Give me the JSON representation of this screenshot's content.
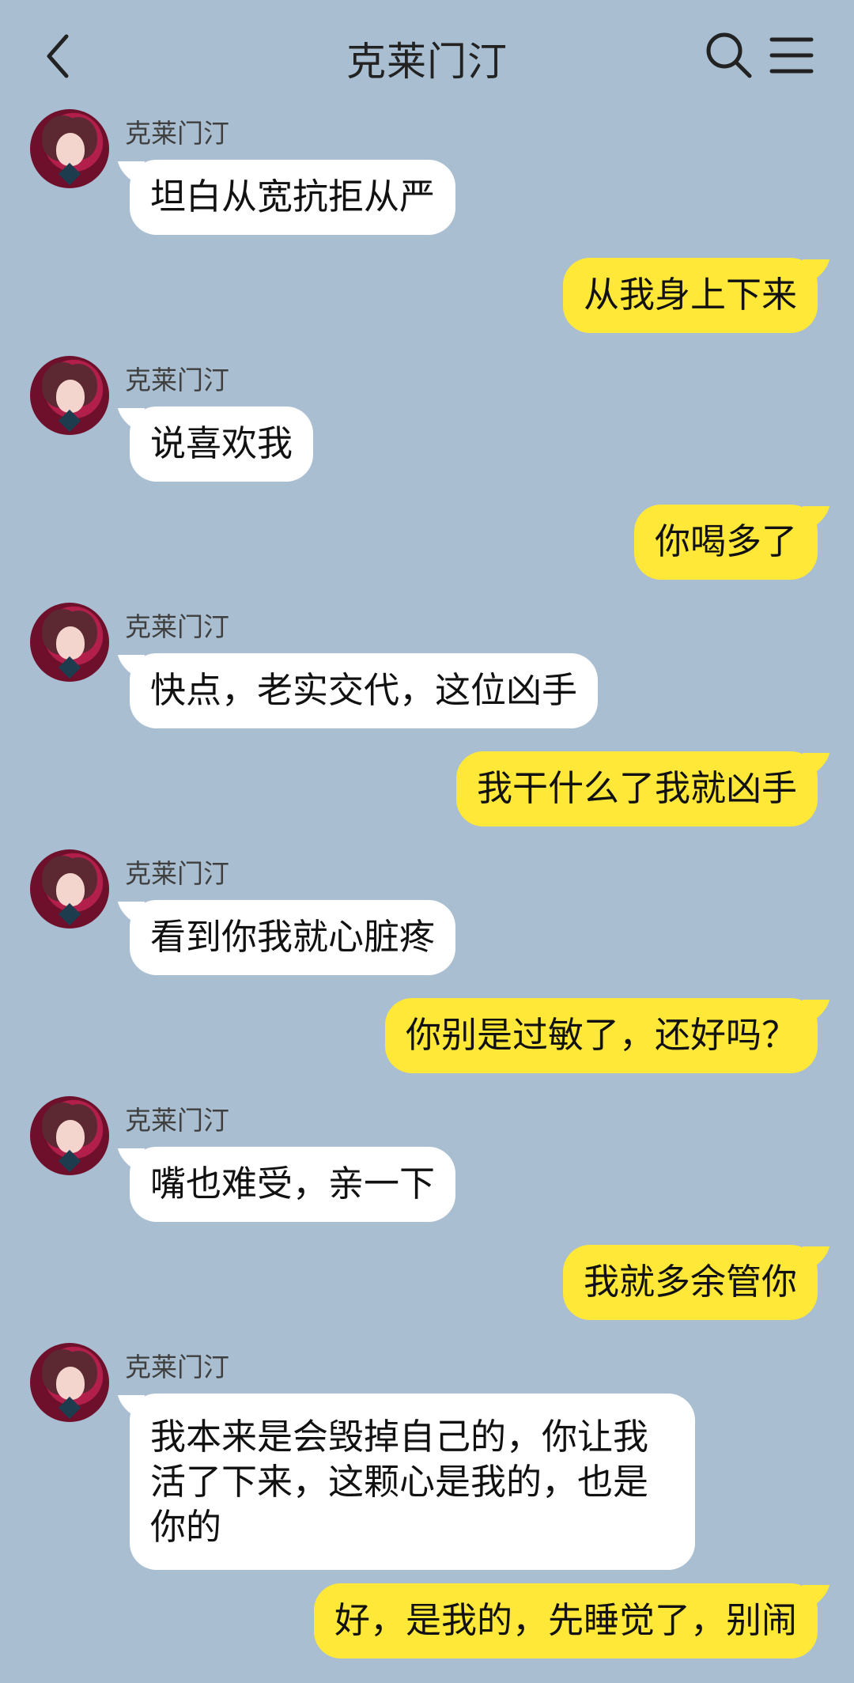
{
  "header": {
    "title": "克莱门汀"
  },
  "icons": {
    "back": "chevron-left-icon",
    "search": "search-icon",
    "menu": "hamburger-menu-icon"
  },
  "messages": [
    {
      "side": "left",
      "sender": "克莱门汀",
      "text": "坦白从宽抗拒从严"
    },
    {
      "side": "right",
      "text": "从我身上下来"
    },
    {
      "side": "left",
      "sender": "克莱门汀",
      "text": "说喜欢我"
    },
    {
      "side": "right",
      "text": "你喝多了"
    },
    {
      "side": "left",
      "sender": "克莱门汀",
      "text": "快点，老实交代，这位凶手"
    },
    {
      "side": "right",
      "text": "我干什么了我就凶手"
    },
    {
      "side": "left",
      "sender": "克莱门汀",
      "text": "看到你我就心脏疼"
    },
    {
      "side": "right",
      "text": "你别是过敏了，还好吗？"
    },
    {
      "side": "left",
      "sender": "克莱门汀",
      "text": "嘴也难受，亲一下"
    },
    {
      "side": "right",
      "text": "我就多余管你"
    },
    {
      "side": "left",
      "sender": "克莱门汀",
      "text": "我本来是会毁掉自己的，你让我活了下来，这颗心是我的，也是你的"
    },
    {
      "side": "right",
      "text": "好，是我的，先睡觉了，别闹"
    }
  ],
  "colors": {
    "background": "#a9bed0",
    "left_bubble": "#ffffff",
    "right_bubble": "#ffe837"
  }
}
